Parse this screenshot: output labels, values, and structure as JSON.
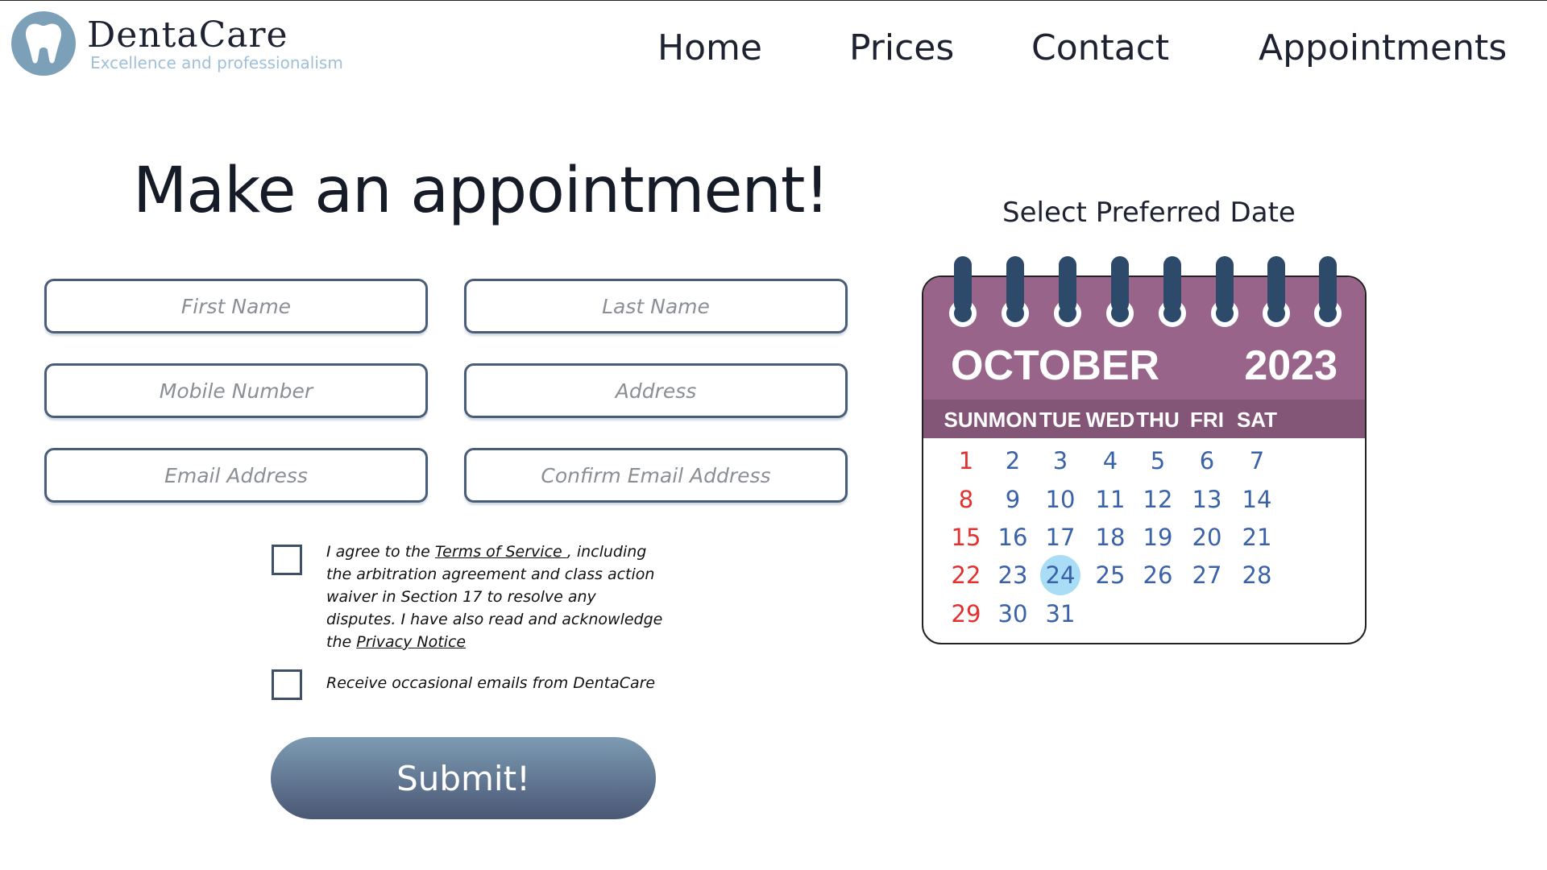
{
  "header": {
    "brand_name": "DentaCare",
    "brand_tagline": "Excellence and professionalism",
    "nav": [
      "Home",
      "Prices",
      "Contact",
      "Appointments"
    ]
  },
  "form": {
    "title": "Make an appointment!",
    "fields": {
      "first_name": "First Name",
      "last_name": "Last Name",
      "mobile": "Mobile Number",
      "address": "Address",
      "email": "Email Address",
      "confirm_email": "Confirm Email Address"
    },
    "terms": {
      "prefix": "I agree to the ",
      "terms_link": "Terms of Service ",
      "middle": ", including the arbitration agreement and class action waiver in Section 17 to resolve any disputes. I have also read and acknowledge the ",
      "privacy_link": "Privacy Notice"
    },
    "newsletter": "Receive occasional emails from DentaCare",
    "submit": "Submit!"
  },
  "calendar": {
    "label": "Select Preferred Date",
    "month": "OCTOBER",
    "year": "2023",
    "days_of_week": [
      "SUN",
      "MON",
      "TUE",
      "WED",
      "THU",
      "FRI",
      "SAT"
    ],
    "weeks": [
      [
        "1",
        "2",
        "3",
        "4",
        "5",
        "6",
        "7"
      ],
      [
        "8",
        "9",
        "10",
        "11",
        "12",
        "13",
        "14"
      ],
      [
        "15",
        "16",
        "17",
        "18",
        "19",
        "20",
        "21"
      ],
      [
        "22",
        "23",
        "24",
        "25",
        "26",
        "27",
        "28"
      ],
      [
        "29",
        "30",
        "31"
      ]
    ],
    "selected_date": "24",
    "colors": {
      "header": "#98648a",
      "weekday_bar": "#835577",
      "date": "#3a62a8",
      "sunday": "#e2312e",
      "selected": "#a9dcf5",
      "rings": "#2d4a6b"
    }
  },
  "icons": {
    "logo": "tooth-icon"
  }
}
